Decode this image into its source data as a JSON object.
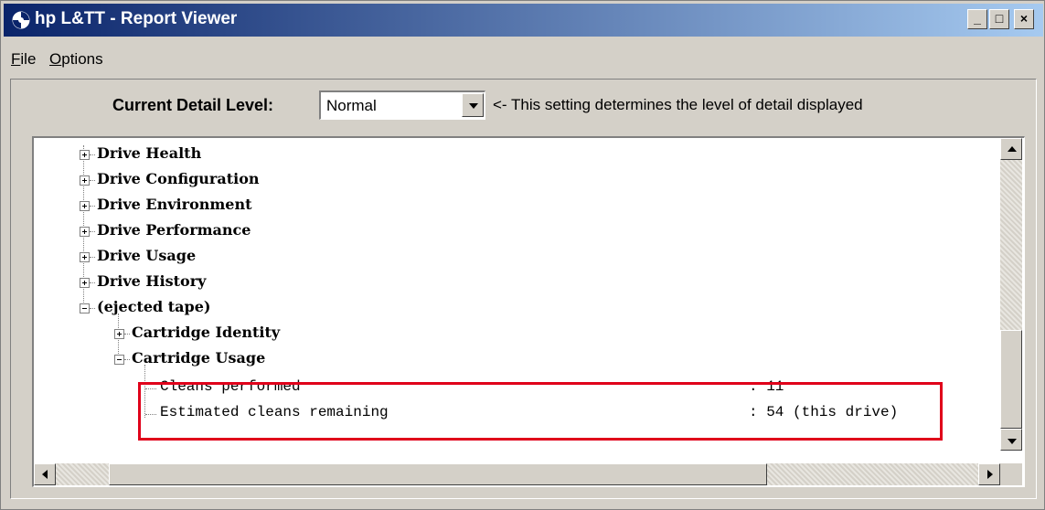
{
  "window": {
    "title": "hp L&TT - Report Viewer",
    "controls": {
      "minimize": "_",
      "maximize": "□",
      "close": "×"
    }
  },
  "menu": {
    "items": [
      {
        "mnemonic": "F",
        "rest": "ile"
      },
      {
        "mnemonic": "O",
        "rest": "ptions"
      }
    ]
  },
  "detail": {
    "label": "Current Detail Level:",
    "value": "Normal",
    "hint": "<- This setting determines the level of detail displayed"
  },
  "tree": {
    "top_nodes": [
      {
        "label": "Drive Health",
        "expanded": false
      },
      {
        "label": "Drive Configuration",
        "expanded": false
      },
      {
        "label": "Drive Environment",
        "expanded": false
      },
      {
        "label": "Drive Performance",
        "expanded": false
      },
      {
        "label": "Drive Usage",
        "expanded": false
      },
      {
        "label": "Drive History",
        "expanded": false
      },
      {
        "label": "(ejected tape)",
        "expanded": true
      }
    ],
    "tape_children": [
      {
        "label": "Cartridge Identity",
        "expanded": false
      },
      {
        "label": "Cartridge Usage",
        "expanded": true
      }
    ],
    "usage_rows": [
      {
        "name": "Cleans performed",
        "value": ": 11"
      },
      {
        "name": "Estimated cleans remaining",
        "value": ": 54 (this drive)"
      }
    ]
  },
  "colors": {
    "highlight": "#e0001a",
    "titlebar": "#0a246a",
    "face": "#d4d0c8"
  },
  "icons": [
    "hp-logo-icon",
    "expand-plus-icon",
    "collapse-minus-icon",
    "dropdown-arrow-icon",
    "scroll-up-icon",
    "scroll-down-icon",
    "scroll-left-icon",
    "scroll-right-icon"
  ]
}
